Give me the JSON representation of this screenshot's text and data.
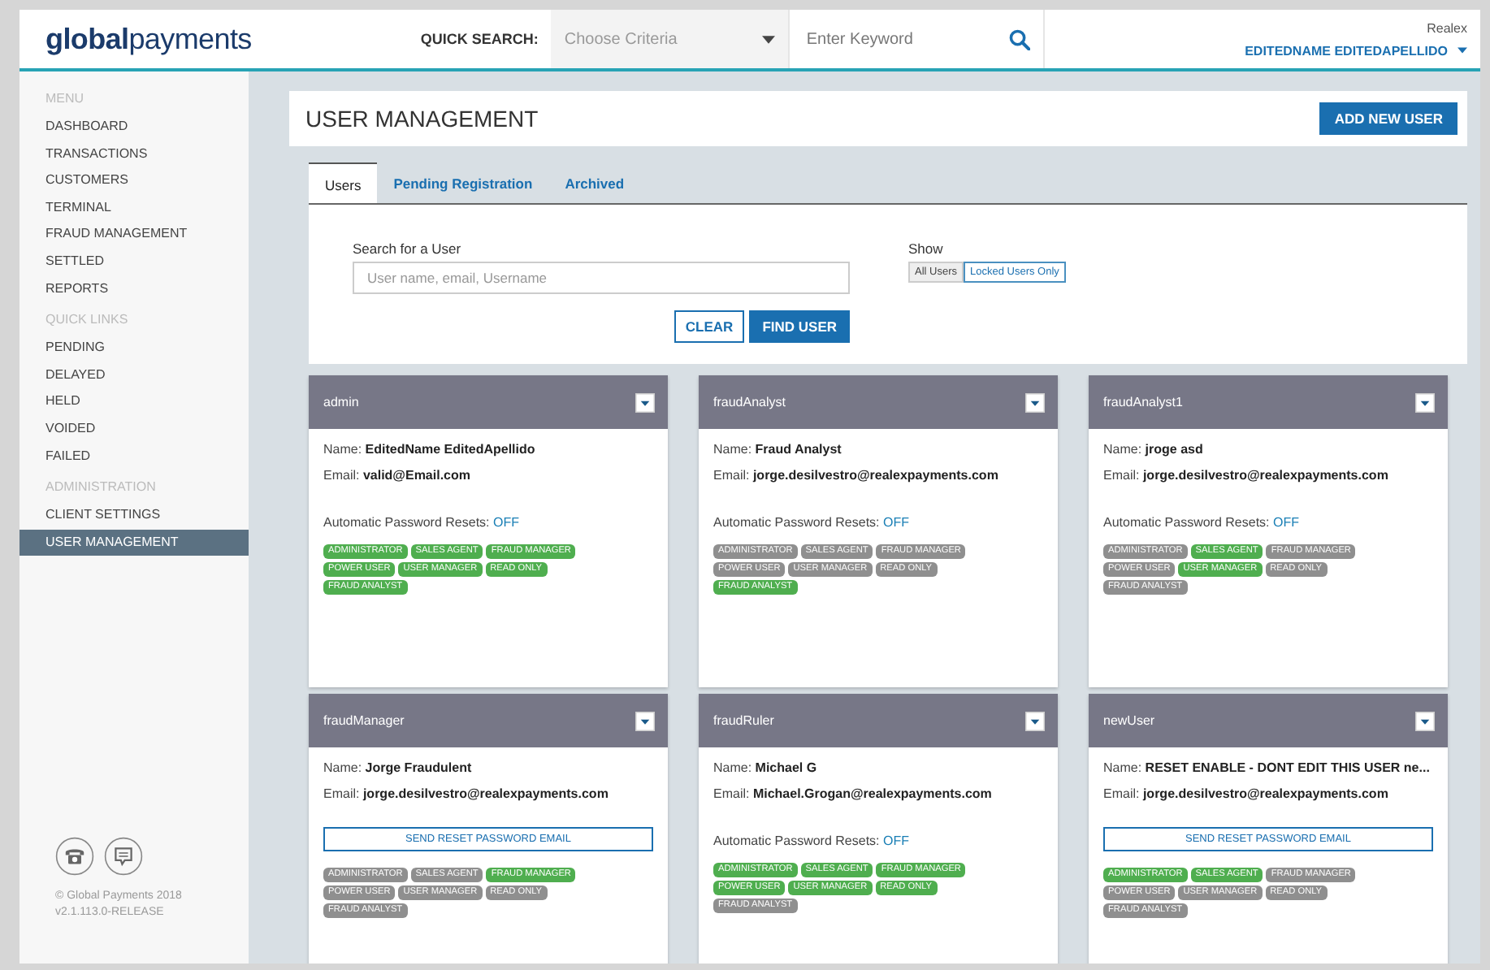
{
  "header": {
    "logo": "**global**payments",
    "quick_search_label": "QUICK SEARCH:",
    "criteria": {
      "placeholder": "Choose Criteria"
    },
    "keyword": {
      "placeholder": "Enter Keyword"
    },
    "company": "Realex",
    "user": "EDITEDNAME EDITEDAPELLIDO"
  },
  "sidebar": {
    "sections": [
      {
        "title": "MENU",
        "items": [
          {
            "label": "DASHBOARD",
            "selected": false
          },
          {
            "label": "TRANSACTIONS",
            "selected": false
          },
          {
            "label": "CUSTOMERS",
            "selected": false
          },
          {
            "label": "TERMINAL",
            "selected": false
          },
          {
            "label": "FRAUD MANAGEMENT",
            "selected": false
          },
          {
            "label": "SETTLED",
            "selected": false
          },
          {
            "label": "REPORTS",
            "selected": false
          }
        ]
      },
      {
        "title": "QUICK LINKS",
        "items": [
          {
            "label": "PENDING",
            "selected": false
          },
          {
            "label": "DELAYED",
            "selected": false
          },
          {
            "label": "HELD",
            "selected": false
          },
          {
            "label": "VOIDED",
            "selected": false
          },
          {
            "label": "FAILED",
            "selected": false
          }
        ]
      },
      {
        "title": "ADMINISTRATION",
        "items": [
          {
            "label": "CLIENT SETTINGS",
            "selected": false
          },
          {
            "label": "USER MANAGEMENT",
            "selected": true
          }
        ]
      }
    ],
    "copyright": "© Global Payments 2018",
    "version": "v2.1.113.0-RELEASE"
  },
  "page": {
    "title": "USER MANAGEMENT",
    "add_button": "ADD NEW USER",
    "tabs": [
      {
        "label": "Users",
        "selected": true
      },
      {
        "label": "Pending Registration",
        "selected": false
      },
      {
        "label": "Archived",
        "selected": false
      }
    ],
    "search": {
      "label": "Search for a User",
      "placeholder": "User name, email, Username"
    },
    "show": {
      "label": "Show",
      "options": [
        {
          "label": "All Users",
          "selected": true
        },
        {
          "label": "Locked Users Only",
          "selected": false
        }
      ]
    },
    "buttons": {
      "clear": "CLEAR",
      "find": "FIND USER"
    },
    "cards": [
      {
        "username": "admin",
        "name_label": "Name:",
        "name": "EditedName EditedApellido",
        "email_label": "Email:",
        "email": "valid@Email.com",
        "kind": "auto_reset",
        "resets_label": "Automatic Password Resets:",
        "resets": "OFF",
        "roles": [
          {
            "label": "ADMINISTRATOR",
            "on": true
          },
          {
            "label": "SALES AGENT",
            "on": true
          },
          {
            "label": "FRAUD MANAGER",
            "on": true
          },
          {
            "label": "POWER USER",
            "on": true
          },
          {
            "label": "USER MANAGER",
            "on": true
          },
          {
            "label": "READ ONLY",
            "on": true
          },
          {
            "label": "FRAUD ANALYST",
            "on": true
          }
        ]
      },
      {
        "username": "fraudAnalyst",
        "name_label": "Name:",
        "name": "Fraud Analyst",
        "email_label": "Email:",
        "email": "jorge.desilvestro@realexpayments.com",
        "kind": "auto_reset",
        "resets_label": "Automatic Password Resets:",
        "resets": "OFF",
        "roles": [
          {
            "label": "ADMINISTRATOR",
            "on": false
          },
          {
            "label": "SALES AGENT",
            "on": false
          },
          {
            "label": "FRAUD MANAGER",
            "on": false
          },
          {
            "label": "POWER USER",
            "on": false
          },
          {
            "label": "USER MANAGER",
            "on": false
          },
          {
            "label": "READ ONLY",
            "on": false
          },
          {
            "label": "FRAUD ANALYST",
            "on": true
          }
        ]
      },
      {
        "username": "fraudAnalyst1",
        "name_label": "Name:",
        "name": "jroge asd",
        "email_label": "Email:",
        "email": "jorge.desilvestro@realexpayments.com",
        "kind": "auto_reset",
        "resets_label": "Automatic Password Resets:",
        "resets": "OFF",
        "roles": [
          {
            "label": "ADMINISTRATOR",
            "on": false
          },
          {
            "label": "SALES AGENT",
            "on": true
          },
          {
            "label": "FRAUD MANAGER",
            "on": false
          },
          {
            "label": "POWER USER",
            "on": false
          },
          {
            "label": "USER MANAGER",
            "on": true
          },
          {
            "label": "READ ONLY",
            "on": false
          },
          {
            "label": "FRAUD ANALYST",
            "on": false
          }
        ]
      },
      {
        "username": "fraudManager",
        "name_label": "Name:",
        "name": "Jorge Fraudulent",
        "email_label": "Email:",
        "email": "jorge.desilvestro@realexpayments.com",
        "kind": "reset_email",
        "reset_button": "SEND RESET PASSWORD EMAIL",
        "roles": [
          {
            "label": "ADMINISTRATOR",
            "on": false
          },
          {
            "label": "SALES AGENT",
            "on": false
          },
          {
            "label": "FRAUD MANAGER",
            "on": true
          },
          {
            "label": "POWER USER",
            "on": false
          },
          {
            "label": "USER MANAGER",
            "on": false
          },
          {
            "label": "READ ONLY",
            "on": false
          },
          {
            "label": "FRAUD ANALYST",
            "on": false
          }
        ]
      },
      {
        "username": "fraudRuler",
        "name_label": "Name:",
        "name": "Michael G",
        "email_label": "Email:",
        "email": "Michael.Grogan@realexpayments.com",
        "kind": "auto_reset",
        "resets_label": "Automatic Password Resets:",
        "resets": "OFF",
        "roles": [
          {
            "label": "ADMINISTRATOR",
            "on": true
          },
          {
            "label": "SALES AGENT",
            "on": true
          },
          {
            "label": "FRAUD MANAGER",
            "on": true
          },
          {
            "label": "POWER USER",
            "on": true
          },
          {
            "label": "USER MANAGER",
            "on": true
          },
          {
            "label": "READ ONLY",
            "on": true
          },
          {
            "label": "FRAUD ANALYST",
            "on": false
          }
        ]
      },
      {
        "username": "newUser",
        "name_label": "Name:",
        "name": "RESET ENABLE - DONT EDIT THIS USER ne...",
        "email_label": "Email:",
        "email": "jorge.desilvestro@realexpayments.com",
        "kind": "reset_email",
        "reset_button": "SEND RESET PASSWORD EMAIL",
        "roles": [
          {
            "label": "ADMINISTRATOR",
            "on": true
          },
          {
            "label": "SALES AGENT",
            "on": true
          },
          {
            "label": "FRAUD MANAGER",
            "on": false
          },
          {
            "label": "POWER USER",
            "on": false
          },
          {
            "label": "USER MANAGER",
            "on": false
          },
          {
            "label": "READ ONLY",
            "on": false
          },
          {
            "label": "FRAUD ANALYST",
            "on": false
          }
        ]
      }
    ]
  }
}
